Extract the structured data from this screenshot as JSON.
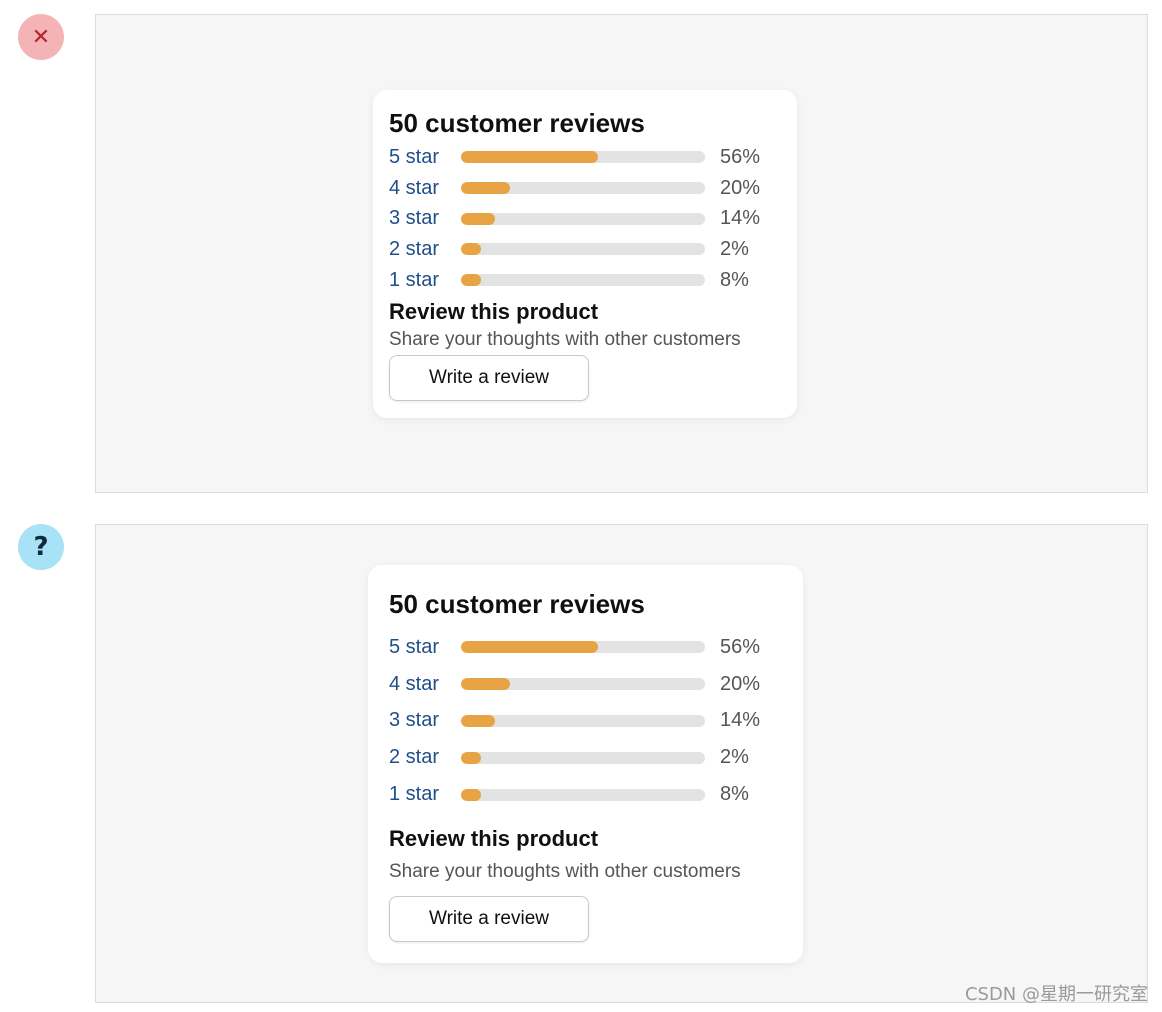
{
  "badges": {
    "bad": {
      "glyph": "✕",
      "icon": "close-icon",
      "color": "#b0242c"
    },
    "question": {
      "glyph": "?",
      "icon": "question-icon",
      "color": "#0f2a3a"
    }
  },
  "review_card": {
    "title": "50 customer reviews",
    "ratings": [
      {
        "label": "5 star",
        "percent_text": "56%",
        "percent": 56
      },
      {
        "label": "4 star",
        "percent_text": "20%",
        "percent": 20
      },
      {
        "label": "3 star",
        "percent_text": "14%",
        "percent": 14
      },
      {
        "label": "2 star",
        "percent_text": "2%",
        "percent": 2
      },
      {
        "label": "1 star",
        "percent_text": "8%",
        "percent": 8
      }
    ],
    "subtitle": "Review this product",
    "subtext": "Share your thoughts with other customers",
    "button_label": "Write a review"
  },
  "colors": {
    "bar_fill": "#e8a444",
    "bar_track": "#e3e3e3",
    "link": "#1f4e8c"
  },
  "watermark": "CSDN @星期一研究室"
}
